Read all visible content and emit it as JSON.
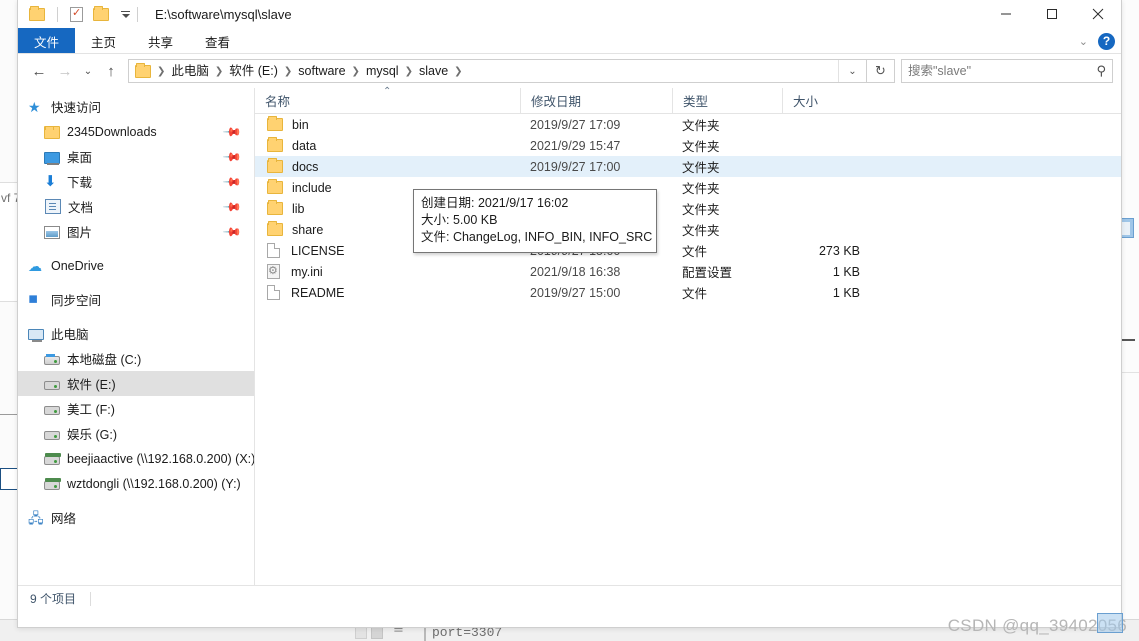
{
  "window": {
    "title": "E:\\software\\mysql\\slave",
    "quick_access_toolbar": [
      {
        "name": "folder-properties",
        "icon": "folder-icon"
      },
      {
        "name": "properties",
        "icon": "properties-checkmark-icon"
      },
      {
        "name": "new-folder",
        "icon": "folder-icon"
      }
    ],
    "controls": {
      "minimize": "–",
      "maximize": "□",
      "close": "✕"
    }
  },
  "ribbon": {
    "tabs": [
      {
        "label": "文件",
        "active": true
      },
      {
        "label": "主页",
        "active": false
      },
      {
        "label": "共享",
        "active": false
      },
      {
        "label": "查看",
        "active": false
      }
    ],
    "expand_label": "⌄",
    "help_label": "?"
  },
  "navigation": {
    "back": "←",
    "forward": "→",
    "recent": "⌄",
    "up": "↑",
    "breadcrumbs": [
      "此电脑",
      "软件 (E:)",
      "software",
      "mysql",
      "slave"
    ],
    "dropdown": "⌄",
    "refresh": "↻"
  },
  "search": {
    "placeholder": "搜索\"slave\"",
    "value": "",
    "icon": "search-icon"
  },
  "sidebar": {
    "groups": [
      {
        "root": {
          "label": "快速访问",
          "icon": "star-pin-icon",
          "indent": 0
        },
        "items": [
          {
            "label": "2345Downloads",
            "icon": "folder-icon",
            "pinned": true
          },
          {
            "label": "桌面",
            "icon": "desktop-icon",
            "pinned": true
          },
          {
            "label": "下载",
            "icon": "download-icon",
            "pinned": true
          },
          {
            "label": "文档",
            "icon": "documents-icon",
            "pinned": true
          },
          {
            "label": "图片",
            "icon": "pictures-icon",
            "pinned": true
          }
        ]
      },
      {
        "root": {
          "label": "OneDrive",
          "icon": "cloud-icon",
          "indent": 0
        },
        "items": []
      },
      {
        "root": {
          "label": "同步空间",
          "icon": "sync-icon",
          "indent": 0
        },
        "items": []
      },
      {
        "root": {
          "label": "此电脑",
          "icon": "this-pc-icon",
          "indent": 0
        },
        "items": [
          {
            "label": "本地磁盘 (C:)",
            "icon": "system-drive-icon",
            "selected": false
          },
          {
            "label": "软件 (E:)",
            "icon": "drive-icon",
            "selected": true
          },
          {
            "label": "美工 (F:)",
            "icon": "drive-icon",
            "selected": false
          },
          {
            "label": "娱乐 (G:)",
            "icon": "drive-icon",
            "selected": false
          },
          {
            "label": "beejiaactive (\\\\192.168.0.200) (X:)",
            "icon": "network-drive-icon",
            "selected": false
          },
          {
            "label": "wztdongli (\\\\192.168.0.200) (Y:)",
            "icon": "network-drive-icon",
            "selected": false
          }
        ]
      },
      {
        "root": {
          "label": "网络",
          "icon": "network-icon",
          "indent": 0
        },
        "items": []
      }
    ]
  },
  "file_list": {
    "columns": [
      {
        "label": "名称",
        "sort": "asc"
      },
      {
        "label": "修改日期",
        "sort": null
      },
      {
        "label": "类型",
        "sort": null
      },
      {
        "label": "大小",
        "sort": null
      }
    ],
    "rows": [
      {
        "name": "bin",
        "date": "2019/9/27 17:09",
        "type": "文件夹",
        "size": "",
        "icon": "folder-icon",
        "selected": false
      },
      {
        "name": "data",
        "date": "2021/9/29 15:47",
        "type": "文件夹",
        "size": "",
        "icon": "folder-icon",
        "selected": false
      },
      {
        "name": "docs",
        "date": "2019/9/27 17:00",
        "type": "文件夹",
        "size": "",
        "icon": "folder-icon",
        "selected": true
      },
      {
        "name": "include",
        "date": "",
        "type": "文件夹",
        "size": "",
        "icon": "folder-icon",
        "selected": false
      },
      {
        "name": "lib",
        "date": "",
        "type": "文件夹",
        "size": "",
        "icon": "folder-icon",
        "selected": false
      },
      {
        "name": "share",
        "date": "",
        "type": "文件夹",
        "size": "",
        "icon": "folder-icon",
        "selected": false
      },
      {
        "name": "LICENSE",
        "date": "2019/9/27 15:00",
        "type": "文件",
        "size": "273 KB",
        "icon": "file-icon",
        "selected": false
      },
      {
        "name": "my.ini",
        "date": "2021/9/18 16:38",
        "type": "配置设置",
        "size": "1 KB",
        "icon": "ini-file-icon",
        "selected": false
      },
      {
        "name": "README",
        "date": "2019/9/27 15:00",
        "type": "文件",
        "size": "1 KB",
        "icon": "file-icon",
        "selected": false
      }
    ]
  },
  "tooltip": {
    "lines": [
      "创建日期: 2021/9/17 16:02",
      "大小: 5.00 KB",
      "文件: ChangeLog, INFO_BIN, INFO_SRC"
    ]
  },
  "statusbar": {
    "item_count": "9 个项目"
  },
  "watermark": {
    "text": "CSDN @qq_39402056"
  },
  "background": {
    "config_text": "port=3307"
  }
}
